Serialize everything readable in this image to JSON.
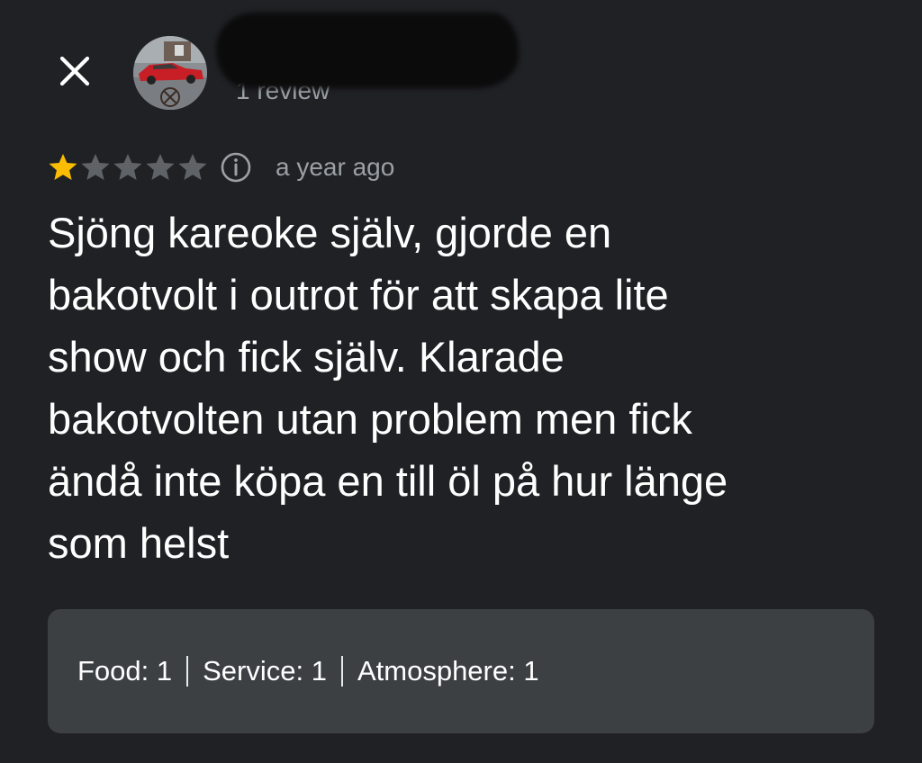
{
  "header": {
    "close_icon": "close-icon",
    "avatar_icon": "avatar-car-photo",
    "review_count": "1 review"
  },
  "review": {
    "rating": 1,
    "rating_max": 5,
    "star_filled_color": "#fbbc04",
    "star_empty_color": "#5f6368",
    "info_icon": "info-icon",
    "time_ago": "a year ago",
    "text": "Sjöng kareoke själv, gjorde en\nbakotvolt i outrot för att skapa lite\nshow och fick själv. Klarade\nbakotvolten utan problem men fick\nändå inte köpa en till öl på hur länge\nsom helst"
  },
  "attributes": [
    {
      "label": "Food: 1"
    },
    {
      "label": "Service: 1"
    },
    {
      "label": "Atmosphere: 1"
    }
  ],
  "colors": {
    "background": "#202124",
    "card": "#3c4043",
    "text": "#ffffff",
    "muted": "#9aa0a6"
  }
}
